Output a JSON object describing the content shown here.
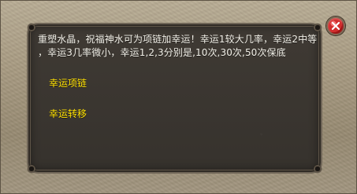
{
  "dialog": {
    "message_lines": [
      "重塑水晶，祝福神水可为项链加幸运！幸运1较大几率，幸运2中等",
      "，幸运3几率微小，幸运1,2,3分别是,10次,30次,50次保底"
    ],
    "options": [
      "幸运项链",
      "幸运转移"
    ]
  },
  "icons": {
    "close": "close-icon"
  },
  "colors": {
    "panel_bg": "#3b3732",
    "frame_bg": "#a89b82",
    "message_text": "#f2f0e8",
    "option_text": "#ffe100",
    "close_button": "#d22d2d"
  }
}
